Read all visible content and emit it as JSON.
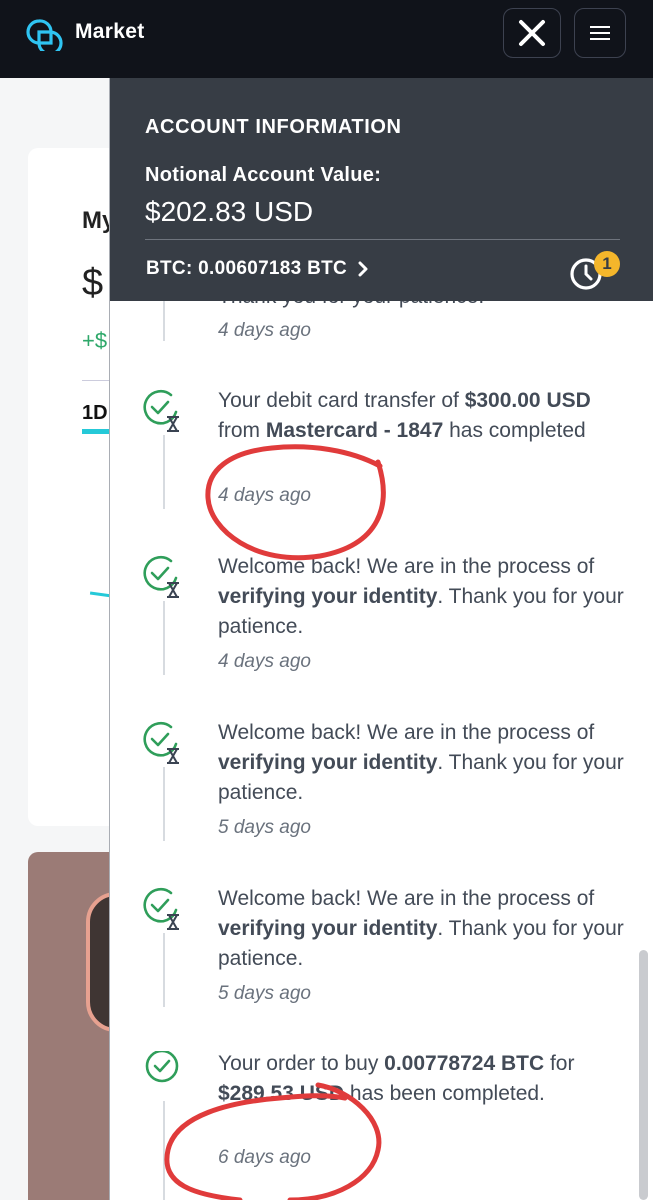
{
  "header": {
    "brand": "Market",
    "logo_icon": "gemini-logo-icon",
    "close_icon": "close-icon",
    "menu_icon": "hamburger-menu-icon"
  },
  "background_page": {
    "title_fragment": "My",
    "value_fragment": "$",
    "change_fragment": "+$",
    "range_tab": "1D"
  },
  "account": {
    "heading": "ACCOUNT INFORMATION",
    "notional_label": "Notional Account Value:",
    "notional_value": "$202.83 USD",
    "btc_balance": "BTC: 0.00607183 BTC",
    "history_badge": "1",
    "colors": {
      "panel": "#373d45",
      "badge": "#f4b62b"
    }
  },
  "notifications": [
    {
      "status": "pending",
      "partial_text": "Thank you for your patience.",
      "time": "4 days ago"
    },
    {
      "status": "pending",
      "pre": "Your debit card transfer of ",
      "bold1": "$300.00 USD",
      "mid": " from ",
      "bold2": "Mastercard - 1847",
      "post": " has completed",
      "time": "4 days ago"
    },
    {
      "status": "pending",
      "pre": "Welcome back! We are in the process of ",
      "bold1": "verifying your identity",
      "post": ". Thank you for your patience.",
      "time": "4 days ago"
    },
    {
      "status": "pending",
      "pre": "Welcome back! We are in the process of ",
      "bold1": "verifying your identity",
      "post": ". Thank you for your patience.",
      "time": "5 days ago"
    },
    {
      "status": "pending",
      "pre": "Welcome back! We are in the process of ",
      "bold1": "verifying your identity",
      "post": ". Thank you for your patience.",
      "time": "5 days ago"
    },
    {
      "status": "completed",
      "pre": "Your order to buy ",
      "bold1": "0.00778724 BTC",
      "mid": " for ",
      "bold2": "$289.53 USD",
      "post": " has been completed.",
      "time": "6 days ago"
    }
  ],
  "colors": {
    "topbar": "#10131a",
    "accent_green": "#2f9e5a",
    "annotation_red": "#e03b3b",
    "chart_cyan": "#25c9d8"
  }
}
